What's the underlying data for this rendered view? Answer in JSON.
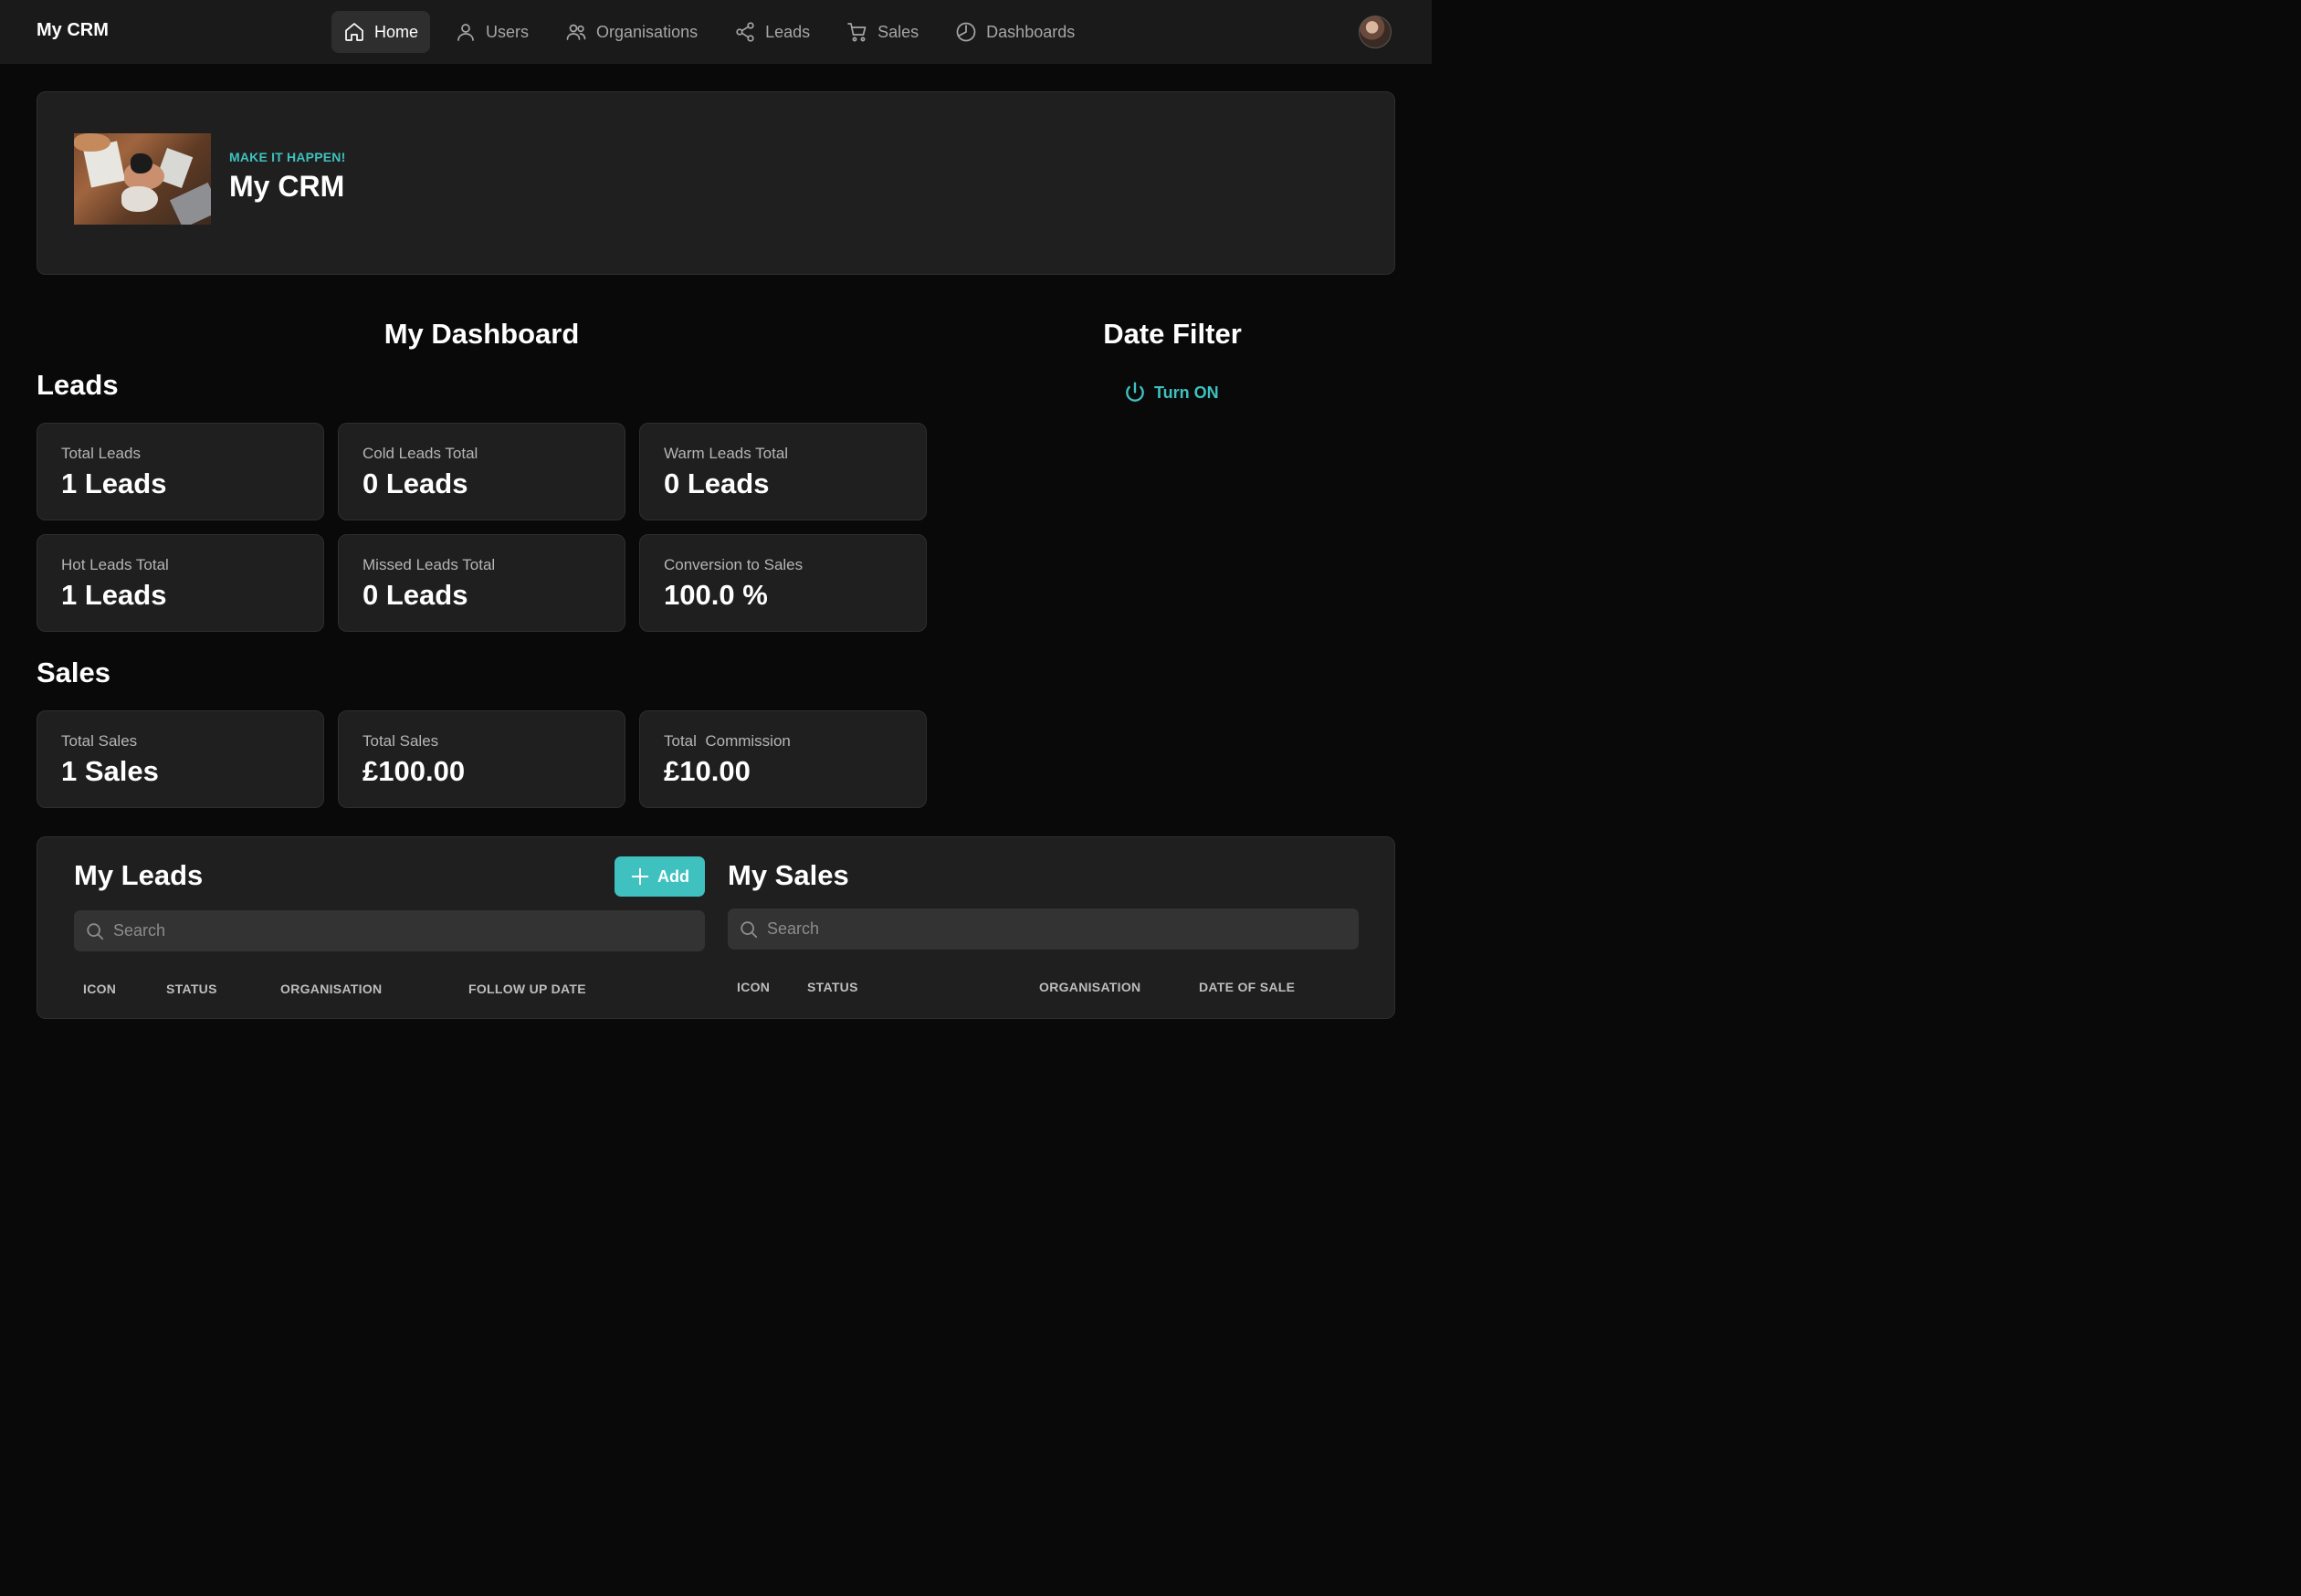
{
  "app": {
    "brand": "My CRM"
  },
  "nav": {
    "items": [
      {
        "label": "Home",
        "icon": "home-icon",
        "active": true
      },
      {
        "label": "Users",
        "icon": "user-icon"
      },
      {
        "label": "Organisations",
        "icon": "users-icon"
      },
      {
        "label": "Leads",
        "icon": "share-icon"
      },
      {
        "label": "Sales",
        "icon": "cart-icon"
      },
      {
        "label": "Dashboards",
        "icon": "chart-pie-icon"
      }
    ]
  },
  "hero": {
    "tagline": "MAKE IT HAPPEN!",
    "title": "My CRM"
  },
  "dashboard": {
    "title": "My Dashboard",
    "date_filter": {
      "title": "Date Filter",
      "toggle_label": "Turn ON"
    },
    "leads": {
      "title": "Leads",
      "stats": [
        {
          "label": "Total Leads",
          "value": "1 Leads"
        },
        {
          "label": "Cold Leads Total",
          "value": "0 Leads"
        },
        {
          "label": "Warm Leads Total",
          "value": "0 Leads"
        },
        {
          "label": "Hot Leads Total",
          "value": "1 Leads"
        },
        {
          "label": "Missed Leads Total",
          "value": "0 Leads"
        },
        {
          "label": "Conversion to Sales",
          "value": "100.0 %"
        }
      ]
    },
    "sales": {
      "title": "Sales",
      "stats": [
        {
          "label": "Total Sales",
          "value": "1 Sales"
        },
        {
          "label": "Total Sales",
          "value": "£100.00"
        },
        {
          "label": "Total  Commission",
          "value": "£10.00"
        }
      ]
    }
  },
  "my_leads": {
    "title": "My Leads",
    "add_label": "Add",
    "search_placeholder": "Search",
    "columns": [
      "ICON",
      "STATUS",
      "ORGANISATION",
      "FOLLOW UP DATE"
    ]
  },
  "my_sales": {
    "title": "My Sales",
    "search_placeholder": "Search",
    "columns": [
      "ICON",
      "STATUS",
      "ORGANISATION",
      "DATE OF SALE"
    ]
  },
  "colors": {
    "accent": "#3ec1bf",
    "background": "#090909",
    "card": "#1f1f1f",
    "nav": "#1a1a1a"
  }
}
